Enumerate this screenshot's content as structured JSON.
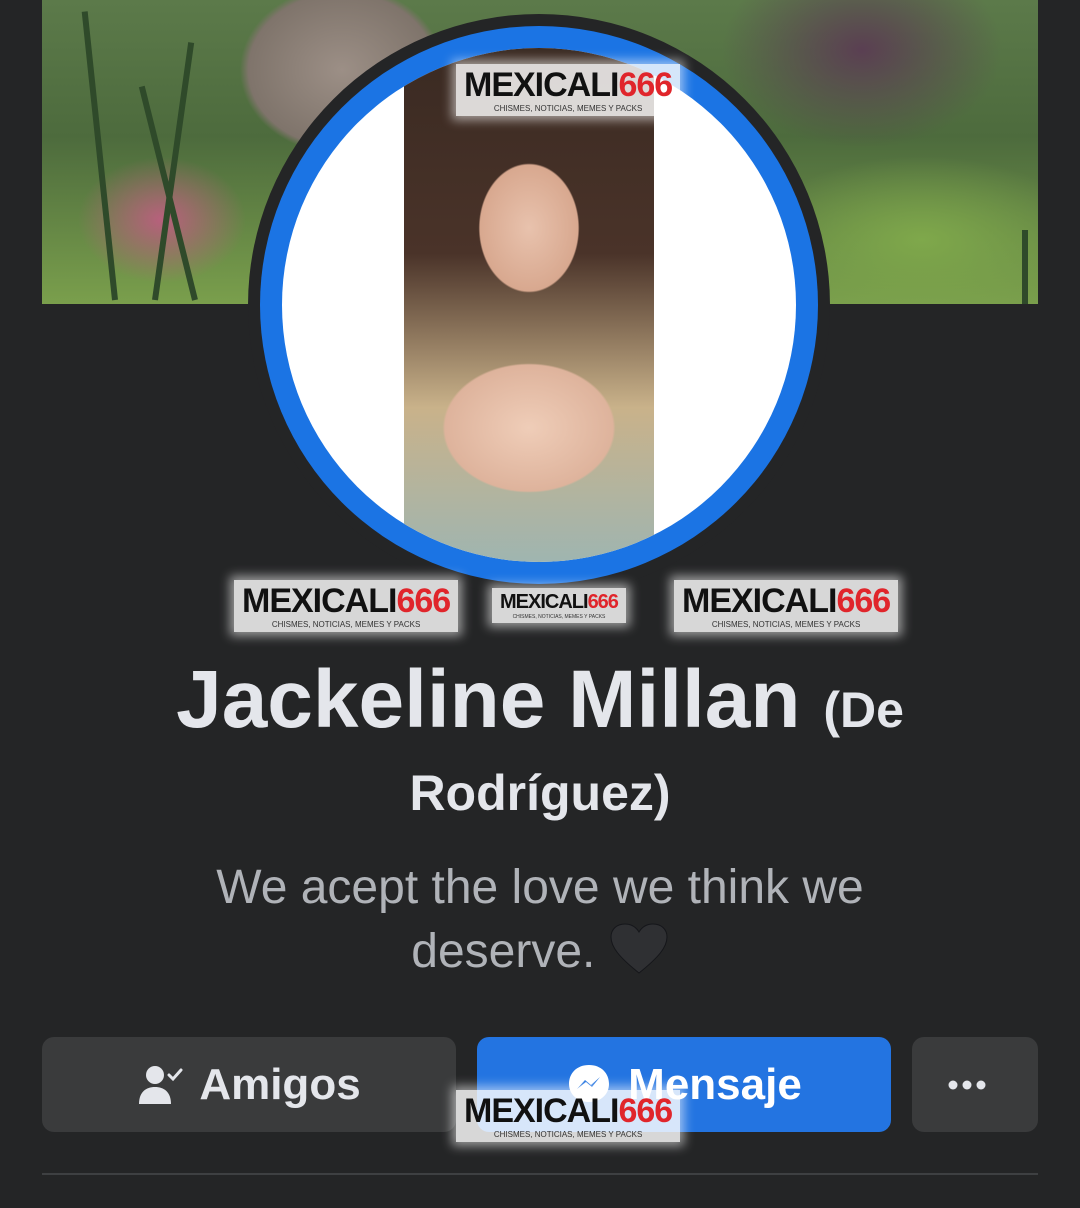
{
  "profile": {
    "name": "Jackeline Millan",
    "alternate_name": "(De",
    "alternate_name_cont": "Rodríguez)",
    "bio": "We acept the love we think we deserve."
  },
  "actions": {
    "friends_label": "Amigos",
    "message_label": "Mensaje",
    "more_icon": "more-dots-icon"
  },
  "watermark": {
    "brand": "MEXICALI",
    "number": "666",
    "tagline": "CHISMES, NOTICIAS, MEMES Y PACKS"
  },
  "colors": {
    "background": "#242526",
    "accent": "#2374e1",
    "avatar_ring": "#1b74e4",
    "secondary_button": "#3a3b3c"
  },
  "icons": [
    "friends-check-icon",
    "messenger-icon",
    "heart-icon",
    "more-dots-icon"
  ]
}
